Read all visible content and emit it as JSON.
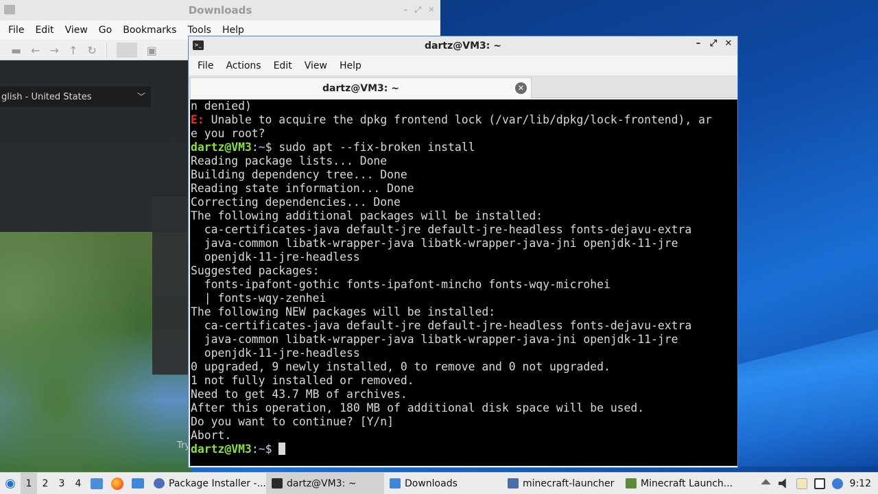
{
  "file_manager": {
    "title": "Downloads",
    "menu": [
      "File",
      "Edit",
      "View",
      "Go",
      "Bookmarks",
      "Tools",
      "Help"
    ]
  },
  "package_installer": {
    "language": "glish - United States",
    "try_label": "Try"
  },
  "terminal": {
    "title": "dartz@VM3: ~",
    "menu": [
      "File",
      "Actions",
      "Edit",
      "View",
      "Help"
    ],
    "tab_label": "dartz@VM3: ~",
    "lines": [
      {
        "text": "n denied)"
      },
      {
        "error_prefix": "E:",
        "text": " Unable to acquire the dpkg frontend lock (/var/lib/dpkg/lock-frontend), ar"
      },
      {
        "text": "e you root?"
      },
      {
        "user": "dartz@VM3",
        "sep": ":",
        "path": "~",
        "prompt": "$ ",
        "text": "sudo apt --fix-broken install"
      },
      {
        "text": "Reading package lists... Done"
      },
      {
        "text": "Building dependency tree... Done"
      },
      {
        "text": "Reading state information... Done"
      },
      {
        "text": "Correcting dependencies... Done"
      },
      {
        "text": "The following additional packages will be installed:"
      },
      {
        "text": "  ca-certificates-java default-jre default-jre-headless fonts-dejavu-extra"
      },
      {
        "text": "  java-common libatk-wrapper-java libatk-wrapper-java-jni openjdk-11-jre"
      },
      {
        "text": "  openjdk-11-jre-headless"
      },
      {
        "text": "Suggested packages:"
      },
      {
        "text": "  fonts-ipafont-gothic fonts-ipafont-mincho fonts-wqy-microhei"
      },
      {
        "text": "  | fonts-wqy-zenhei"
      },
      {
        "text": "The following NEW packages will be installed:"
      },
      {
        "text": "  ca-certificates-java default-jre default-jre-headless fonts-dejavu-extra"
      },
      {
        "text": "  java-common libatk-wrapper-java libatk-wrapper-java-jni openjdk-11-jre"
      },
      {
        "text": "  openjdk-11-jre-headless"
      },
      {
        "text": "0 upgraded, 9 newly installed, 0 to remove and 0 not upgraded."
      },
      {
        "text": "1 not fully installed or removed."
      },
      {
        "text": "Need to get 43.7 MB of archives."
      },
      {
        "text": "After this operation, 180 MB of additional disk space will be used."
      },
      {
        "text": "Do you want to continue? [Y/n]"
      },
      {
        "text": "Abort."
      },
      {
        "user": "dartz@VM3",
        "sep": ":",
        "path": "~",
        "prompt": "$ ",
        "text": "",
        "cursor": true
      }
    ]
  },
  "taskbar": {
    "workspaces": [
      "1",
      "2",
      "3",
      "4"
    ],
    "active_workspace": "1",
    "tasks": [
      {
        "label": "Package Installer -...",
        "icon": "package-installer-icon"
      },
      {
        "label": "dartz@VM3: ~",
        "icon": "terminal-icon",
        "active": true
      },
      {
        "label": "Downloads",
        "icon": "folder-icon"
      },
      {
        "label": "minecraft-launcher",
        "icon": "window-icon"
      },
      {
        "label": "Minecraft Launch...",
        "icon": "minecraft-icon"
      }
    ],
    "clock": "9:12"
  },
  "colors": {
    "terminal_error": "#ef2929",
    "terminal_user": "#8ae234",
    "terminal_path": "#729fcf",
    "window_border": "#4b89d0"
  }
}
